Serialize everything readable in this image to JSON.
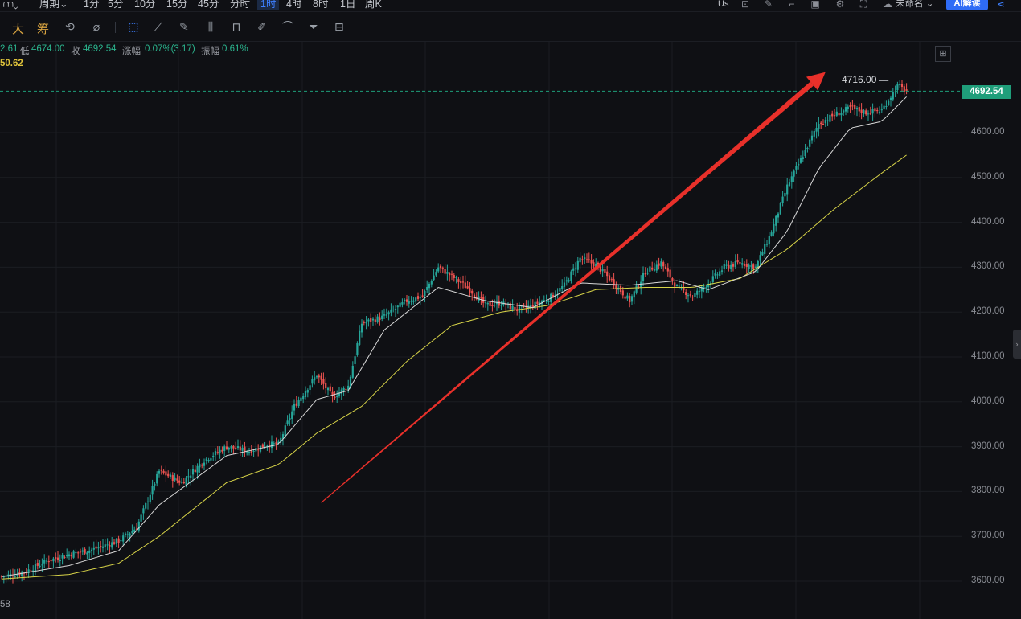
{
  "toolbar": {
    "items": [
      {
        "label": "⩋⌄"
      },
      {
        "label": "周期⌄"
      },
      {
        "label": "1分"
      },
      {
        "label": "5分"
      },
      {
        "label": "10分"
      },
      {
        "label": "15分"
      },
      {
        "label": "45分"
      },
      {
        "label": "分时"
      },
      {
        "label": "1时"
      },
      {
        "label": "4时"
      },
      {
        "label": "8时"
      },
      {
        "label": "1日"
      },
      {
        "label": "周K"
      }
    ],
    "active_label": "1时",
    "us_label": "Us",
    "account_label": "未命名",
    "ai_button": "AI解读"
  },
  "drawing_toolbar": {
    "da_label": "大",
    "chou_label": "筹",
    "tools": [
      "undo-redo-icon",
      "brush-icon",
      "select-icon",
      "ruler-icon",
      "pen-icon",
      "candles-icon",
      "lock-icon",
      "edit-icon",
      "magnet-icon",
      "filter-icon",
      "trash-icon"
    ]
  },
  "info_line": {
    "high_fragment": "2.61",
    "low_label": "低",
    "low_value": "4674.00",
    "close_label": "收",
    "close_value": "4692.54",
    "change_label": "涨幅",
    "change_value": "0.07%(3.17)",
    "amplitude_label": "振幅",
    "amplitude_value": "0.61%",
    "ma_fragment": "50.62"
  },
  "price_axis": {
    "ticks": [
      "4600.00",
      "4500.00",
      "4400.00",
      "4300.00",
      "4200.00",
      "4100.00",
      "4000.00",
      "3900.00",
      "3800.00",
      "3700.00",
      "3600.00"
    ],
    "current_price": "4692.54"
  },
  "annotations": {
    "high_label": "4716.00",
    "bottom_left": "58"
  },
  "colors": {
    "up": "#26a69a",
    "down": "#ef5350",
    "ma_fast": "#d7d7d7",
    "ma_slow": "#d8d448",
    "arrow": "#e8302a",
    "accent": "#2f6cf6"
  },
  "chart_data": {
    "type": "candlestick",
    "ylim": [
      3550,
      4760
    ],
    "y_ticks": [
      3600,
      3700,
      3800,
      3900,
      4000,
      4100,
      4200,
      4300,
      4400,
      4500,
      4600
    ],
    "current_price": 4692.54,
    "high_marker": 4716.0,
    "low": 4674.0,
    "close": 4692.54,
    "series_close_path": [
      [
        0,
        3610
      ],
      [
        10,
        3620
      ],
      [
        20,
        3645
      ],
      [
        30,
        3660
      ],
      [
        40,
        3670
      ],
      [
        52,
        3690
      ],
      [
        60,
        3720
      ],
      [
        70,
        3845
      ],
      [
        80,
        3820
      ],
      [
        90,
        3870
      ],
      [
        100,
        3900
      ],
      [
        110,
        3890
      ],
      [
        118,
        3905
      ],
      [
        123,
        3905
      ],
      [
        130,
        3990
      ],
      [
        140,
        4060
      ],
      [
        147,
        4010
      ],
      [
        154,
        4035
      ],
      [
        160,
        4175
      ],
      [
        170,
        4190
      ],
      [
        180,
        4225
      ],
      [
        187,
        4235
      ],
      [
        194,
        4300
      ],
      [
        200,
        4280
      ],
      [
        208,
        4250
      ],
      [
        215,
        4215
      ],
      [
        222,
        4220
      ],
      [
        229,
        4205
      ],
      [
        236,
        4215
      ],
      [
        243,
        4230
      ],
      [
        250,
        4260
      ],
      [
        257,
        4320
      ],
      [
        264,
        4305
      ],
      [
        271,
        4270
      ],
      [
        279,
        4225
      ],
      [
        286,
        4290
      ],
      [
        293,
        4310
      ],
      [
        300,
        4255
      ],
      [
        307,
        4235
      ],
      [
        314,
        4265
      ],
      [
        321,
        4300
      ],
      [
        328,
        4310
      ],
      [
        335,
        4300
      ],
      [
        342,
        4380
      ],
      [
        349,
        4480
      ],
      [
        356,
        4550
      ],
      [
        363,
        4620
      ],
      [
        370,
        4640
      ],
      [
        377,
        4655
      ],
      [
        384,
        4645
      ],
      [
        391,
        4650
      ],
      [
        398,
        4705
      ],
      [
        402,
        4692.54
      ]
    ],
    "ma_fast": [
      [
        0,
        3610
      ],
      [
        30,
        3635
      ],
      [
        52,
        3668
      ],
      [
        70,
        3770
      ],
      [
        100,
        3880
      ],
      [
        123,
        3905
      ],
      [
        140,
        4005
      ],
      [
        154,
        4025
      ],
      [
        170,
        4160
      ],
      [
        194,
        4255
      ],
      [
        215,
        4225
      ],
      [
        236,
        4210
      ],
      [
        257,
        4265
      ],
      [
        279,
        4260
      ],
      [
        300,
        4270
      ],
      [
        314,
        4250
      ],
      [
        335,
        4290
      ],
      [
        349,
        4380
      ],
      [
        363,
        4520
      ],
      [
        377,
        4610
      ],
      [
        391,
        4625
      ],
      [
        402,
        4680
      ]
    ],
    "ma_slow": [
      [
        0,
        3605
      ],
      [
        30,
        3615
      ],
      [
        52,
        3640
      ],
      [
        70,
        3700
      ],
      [
        100,
        3820
      ],
      [
        123,
        3860
      ],
      [
        140,
        3930
      ],
      [
        160,
        3990
      ],
      [
        180,
        4090
      ],
      [
        200,
        4170
      ],
      [
        222,
        4200
      ],
      [
        243,
        4215
      ],
      [
        264,
        4250
      ],
      [
        286,
        4255
      ],
      [
        307,
        4255
      ],
      [
        328,
        4275
      ],
      [
        349,
        4340
      ],
      [
        370,
        4430
      ],
      [
        391,
        4510
      ],
      [
        402,
        4550
      ]
    ],
    "trend_arrow": {
      "from": [
        142,
        3775
      ],
      "to": [
        366,
        4735
      ]
    }
  }
}
